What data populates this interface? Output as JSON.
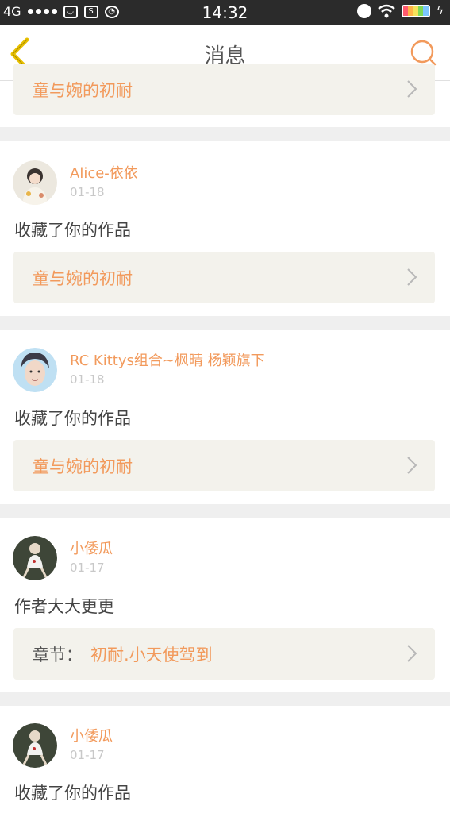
{
  "colors": {
    "accent": "#f29a5c",
    "back": "#e8c000",
    "box_bg": "#f3f2ec",
    "status_bar": "#2b2b2b"
  },
  "status_bar": {
    "network": "4G",
    "time": "14:32"
  },
  "header": {
    "title": "消息",
    "back_icon": "chevron-left-icon",
    "search_icon": "search-icon"
  },
  "messages": [
    {
      "box_title": "童与婉的初耐"
    },
    {
      "user": "Alice-依依",
      "date": "01-18",
      "action": "收藏了你的作品",
      "box_title": "童与婉的初耐"
    },
    {
      "user": "RC Kittys组合~枫晴 杨颖旗下",
      "date": "01-18",
      "action": "收藏了你的作品",
      "box_title": "童与婉的初耐"
    },
    {
      "user": "小倭瓜",
      "date": "01-17",
      "action": "作者大大更更",
      "box_prefix": "章节：",
      "box_title": "初耐.小天使驾到"
    },
    {
      "user": "小倭瓜",
      "date": "01-17",
      "action": "收藏了你的作品"
    }
  ]
}
